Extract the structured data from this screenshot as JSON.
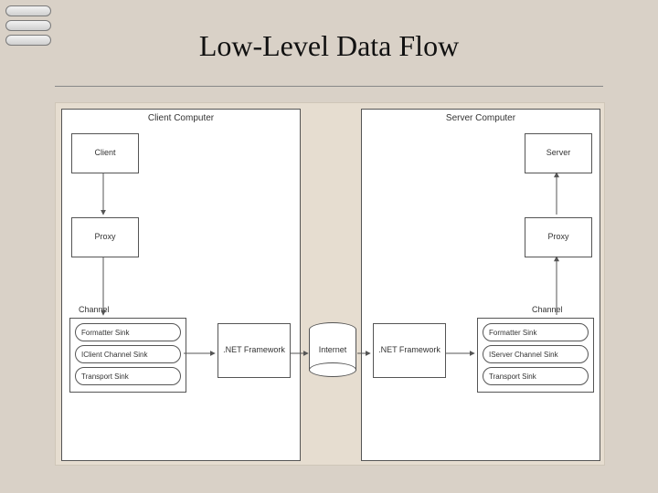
{
  "title": "Low-Level Data Flow",
  "left": {
    "header": "Client Computer",
    "client": "Client",
    "proxy": "Proxy",
    "channel_label": "Channel",
    "sinks": [
      "Formatter Sink",
      "IClient Channel Sink",
      "Transport Sink"
    ]
  },
  "right": {
    "header": "Server Computer",
    "server": "Server",
    "proxy": "Proxy",
    "channel_label": "Channel",
    "sinks": [
      "Formatter Sink",
      "IServer Channel Sink",
      "Transport Sink"
    ]
  },
  "netfx_left": ".NET Framework",
  "internet": "Internet",
  "netfx_right": ".NET Framework"
}
